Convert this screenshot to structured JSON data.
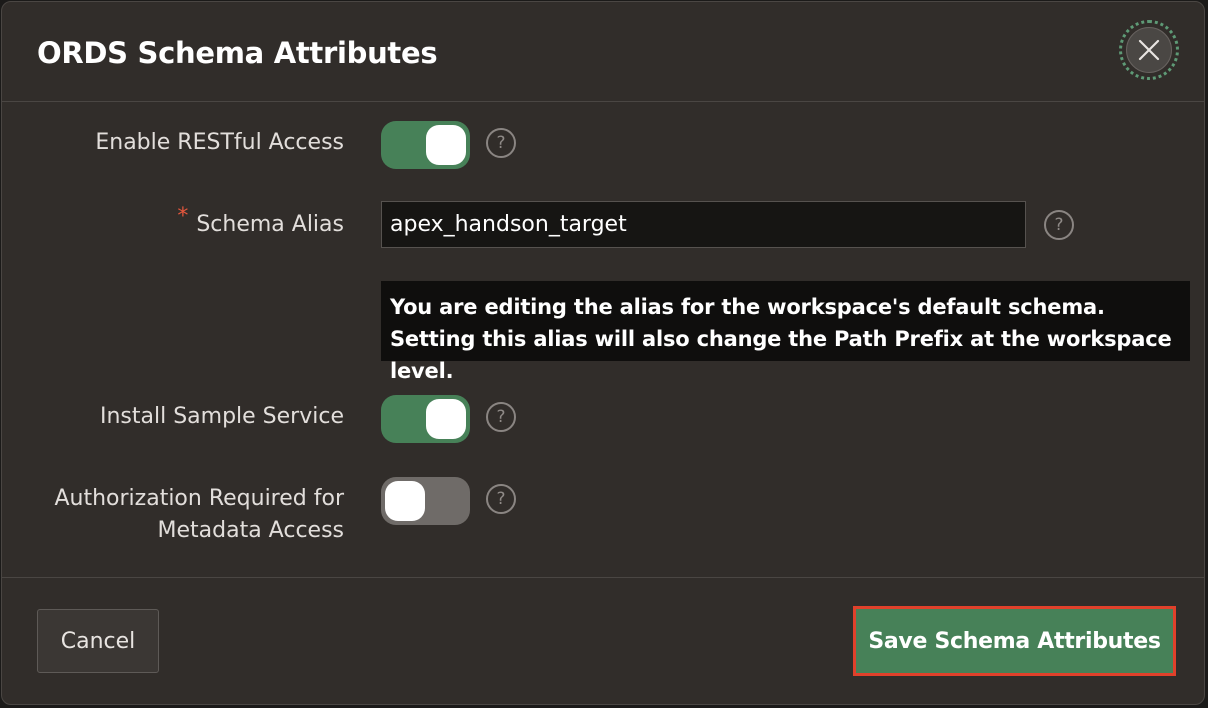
{
  "dialog": {
    "title": "ORDS Schema Attributes",
    "close_icon": "close-icon"
  },
  "fields": {
    "enable_restful": {
      "label": "Enable RESTful Access",
      "value": "on"
    },
    "schema_alias": {
      "required_marker": "*",
      "label": "Schema Alias",
      "value": "apex_handson_target"
    },
    "alias_notice": "You are editing the alias for the workspace's default schema. Setting this alias will also change the Path Prefix at the workspace level.",
    "install_sample": {
      "label": "Install Sample Service",
      "value": "on"
    },
    "auth_metadata": {
      "label_line1": "Authorization Required for",
      "label_line2": "Metadata Access",
      "value": "off"
    },
    "help_glyph": "?"
  },
  "footer": {
    "cancel_label": "Cancel",
    "save_label": "Save Schema Attributes"
  },
  "colors": {
    "toggle_on": "#478158",
    "toggle_off": "#6f6b68",
    "save_button": "#478158",
    "highlight_border": "#e0412b",
    "required": "#e5573d"
  }
}
